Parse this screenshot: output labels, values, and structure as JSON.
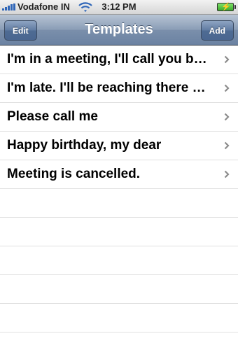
{
  "status_bar": {
    "carrier": "Vodafone IN",
    "time": "3:12 PM",
    "signal_bars": 5,
    "battery": "charging"
  },
  "nav_bar": {
    "title": "Templates",
    "left_button": "Edit",
    "right_button": "Add"
  },
  "templates": [
    {
      "label": "I'm in a meeting, I'll call you back"
    },
    {
      "label": "I'm late. I'll be reaching there soon"
    },
    {
      "label": "Please call me"
    },
    {
      "label": "Happy birthday, my dear"
    },
    {
      "label": "Meeting is cancelled."
    }
  ],
  "icons": {
    "signal": "signal-strength-icon",
    "wifi": "wifi-icon",
    "battery": "battery-charging-icon",
    "disclosure": "chevron-right-icon"
  },
  "colors": {
    "nav_bar": "#7a8fab",
    "signal": "#2f66b8",
    "battery_fill": "#3aa92a",
    "chevron": "#8c8c8c",
    "separator": "#e0e0e0"
  }
}
